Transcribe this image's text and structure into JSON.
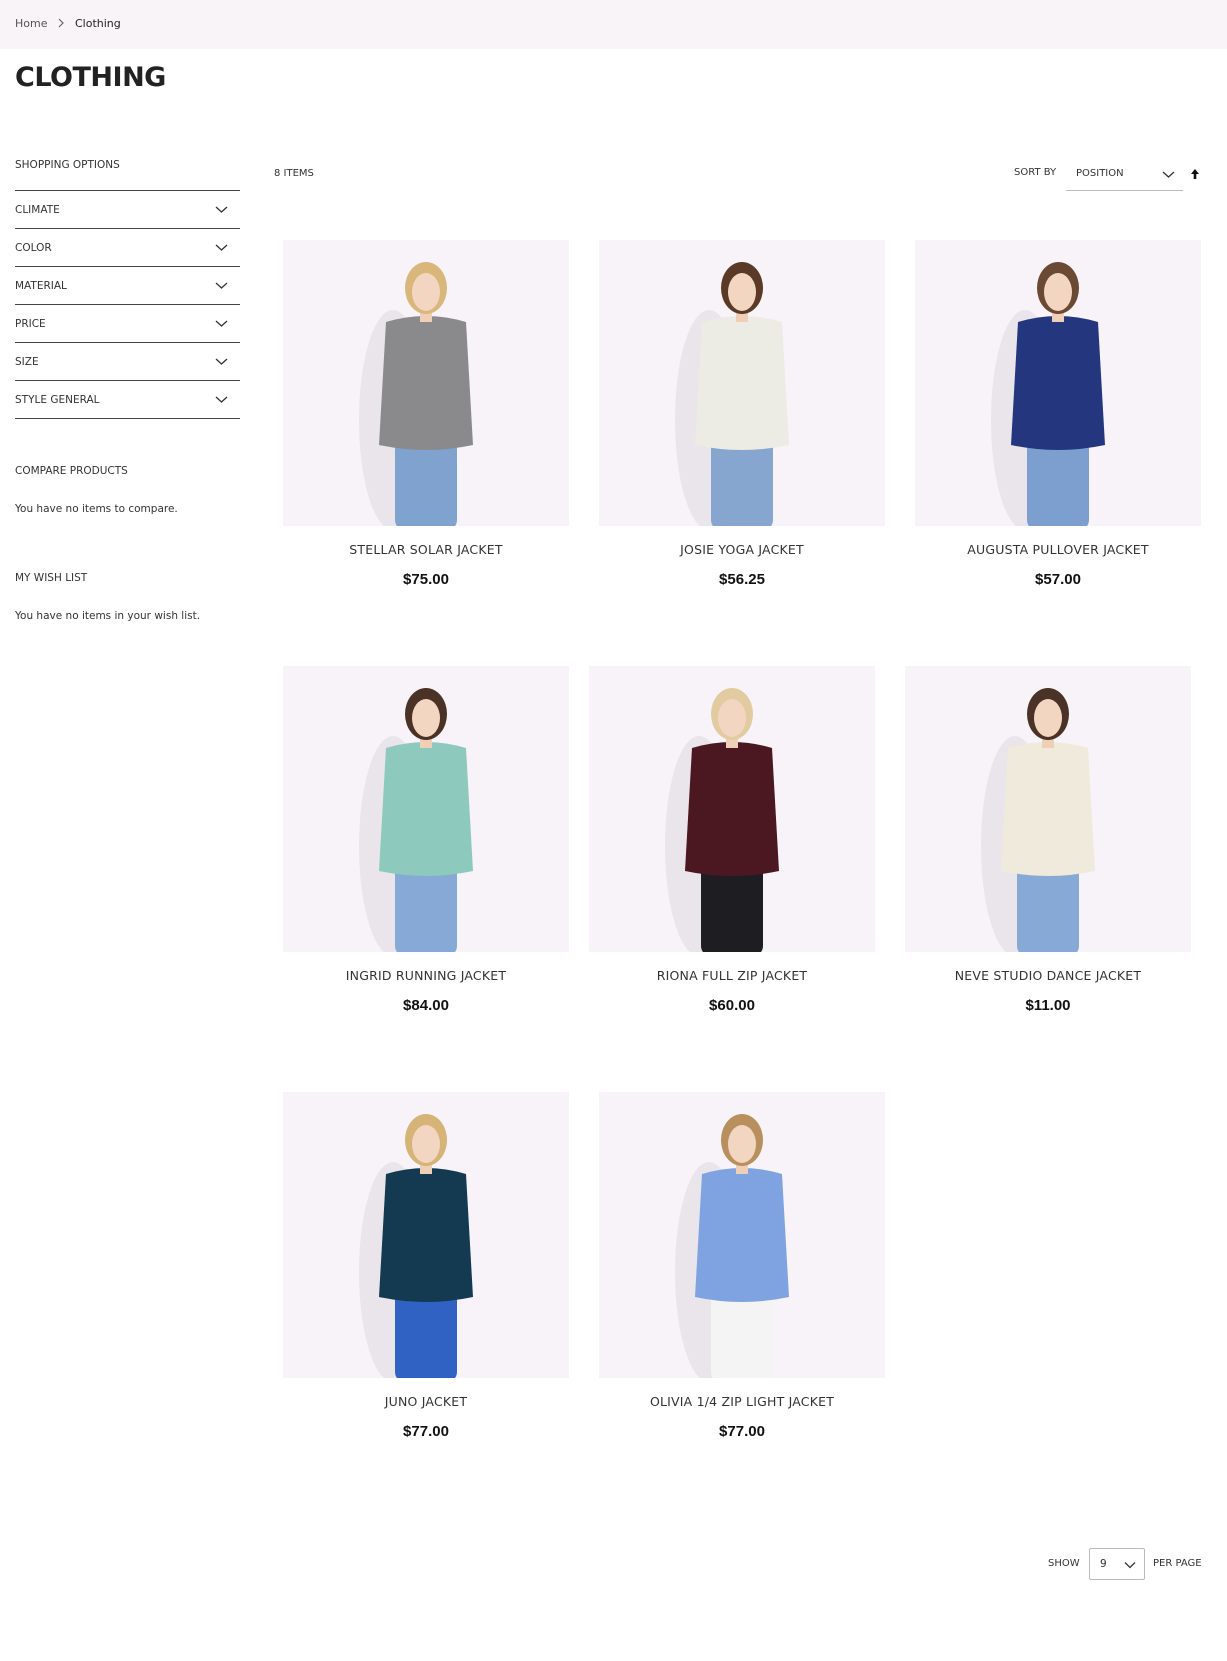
{
  "breadcrumb": {
    "home": "Home",
    "current": "Clothing"
  },
  "page": {
    "title": "CLOTHING"
  },
  "sidebar": {
    "shopping_options_title": "SHOPPING OPTIONS",
    "filters": [
      {
        "label": "CLIMATE"
      },
      {
        "label": "COLOR"
      },
      {
        "label": "MATERIAL"
      },
      {
        "label": "PRICE"
      },
      {
        "label": "SIZE"
      },
      {
        "label": "STYLE GENERAL"
      }
    ],
    "compare": {
      "title": "COMPARE PRODUCTS",
      "empty": "You have no items to compare."
    },
    "wishlist": {
      "title": "MY WISH LIST",
      "empty": "You have no items in your wish list."
    }
  },
  "toolbar": {
    "count": "8 ITEMS",
    "sort_label": "SORT BY",
    "sort_value": "POSITION"
  },
  "products": [
    {
      "name": "STELLAR SOLAR JACKET",
      "price": "$75.00",
      "hair": "#d9b67a",
      "top": "#8a8a8c",
      "bottom": "#7fa2cf"
    },
    {
      "name": "JOSIE YOGA JACKET",
      "price": "$56.25",
      "hair": "#5a3a27",
      "top": "#ecebe4",
      "bottom": "#86a6cf"
    },
    {
      "name": "AUGUSTA PULLOVER JACKET",
      "price": "$57.00",
      "hair": "#6b4a34",
      "top": "#24377e",
      "bottom": "#7d9fd0"
    },
    {
      "name": "INGRID RUNNING JACKET",
      "price": "$84.00",
      "hair": "#4a3226",
      "top": "#8ec9bd",
      "bottom": "#86a9d6"
    },
    {
      "name": "RIONA FULL ZIP JACKET",
      "price": "$60.00",
      "hair": "#e2cba0",
      "top": "#4b1720",
      "bottom": "#1e1e22"
    },
    {
      "name": "NEVE STUDIO DANCE JACKET",
      "price": "$11.00",
      "hair": "#4a3226",
      "top": "#efeadc",
      "bottom": "#86a9d6"
    },
    {
      "name": "JUNO JACKET",
      "price": "$77.00",
      "hair": "#d6b377",
      "top": "#143a52",
      "bottom": "#2f62c2"
    },
    {
      "name": "OLIVIA 1/4 ZIP LIGHT JACKET",
      "price": "$77.00",
      "hair": "#b8905e",
      "top": "#7ea3e0",
      "bottom": "#f4f4f4"
    }
  ],
  "limiter": {
    "show_label": "SHOW",
    "value": "9",
    "per_page_label": "PER PAGE"
  }
}
